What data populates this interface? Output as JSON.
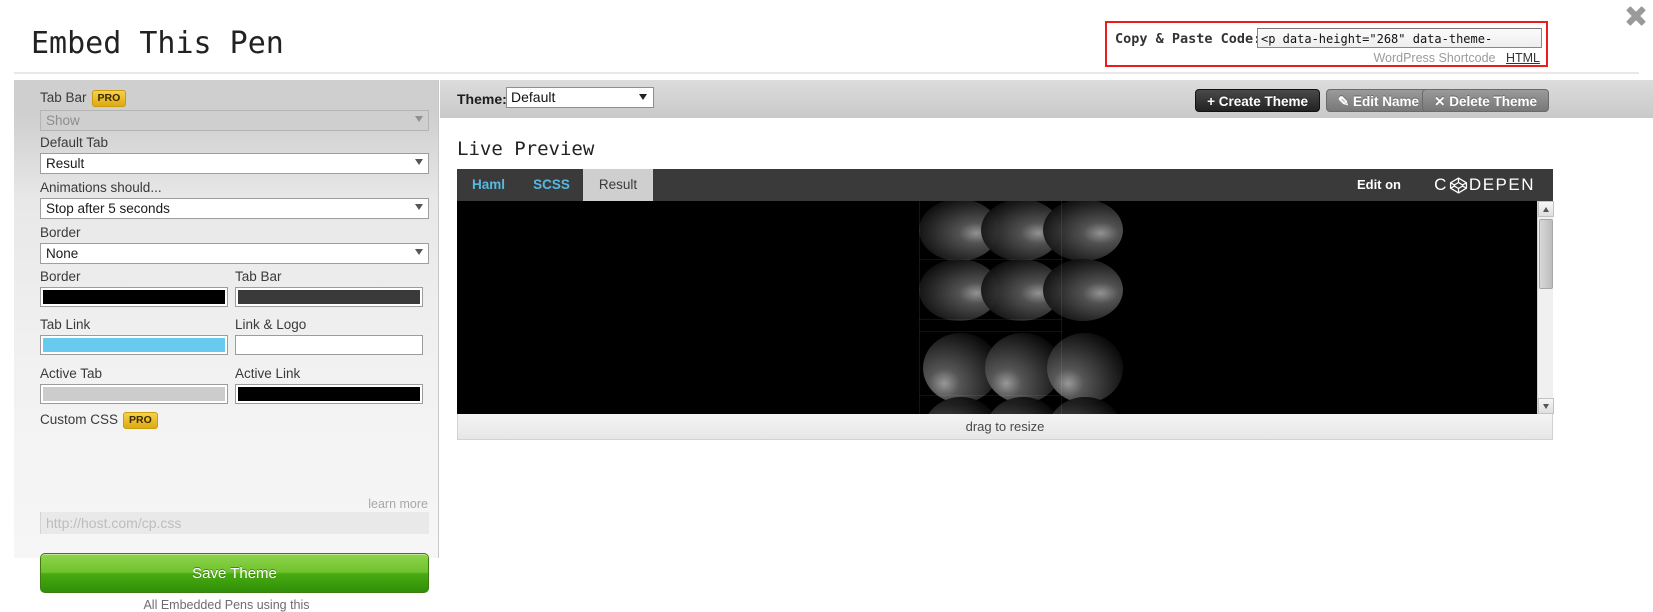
{
  "page": {
    "title": "Embed This Pen",
    "close_icon": "close-x-icon"
  },
  "copy_paste": {
    "label": "Copy & Paste Code:",
    "code_value": "<p data-height=\"268\" data-theme-",
    "wordpress_link": "WordPress Shortcode",
    "html_link": "HTML"
  },
  "sidebar": {
    "fields": [
      {
        "label": "Tab Bar",
        "pro": "PRO",
        "value": "Show",
        "disabled": true
      },
      {
        "label": "Default Tab",
        "pro": "",
        "value": "Result",
        "disabled": false
      },
      {
        "label": "Animations should...",
        "pro": "",
        "value": "Stop after 5 seconds",
        "disabled": false
      },
      {
        "label": "Border",
        "pro": "",
        "value": "None",
        "disabled": false
      }
    ],
    "colors": [
      {
        "label": "Border",
        "hex": "#000000"
      },
      {
        "label": "Tab Bar",
        "hex": "#3a3a3a"
      },
      {
        "label": "Tab Link",
        "hex": "#69caf0"
      },
      {
        "label": "Link & Logo",
        "hex": "#ffffff"
      },
      {
        "label": "Active Tab",
        "hex": "#cccccc"
      },
      {
        "label": "Active Link",
        "hex": "#000000"
      }
    ],
    "custom_css": {
      "label": "Custom CSS",
      "pro": "PRO",
      "learn_more": "learn more",
      "placeholder": "http://host.com/cp.css",
      "value": ""
    },
    "save_label": "Save Theme",
    "save_note": "All Embedded Pens using this"
  },
  "theme_bar": {
    "label": "Theme:",
    "selected": "Default",
    "create_label": "+ Create Theme",
    "edit_label": "✎ Edit Name",
    "delete_label": "✕ Delete Theme"
  },
  "preview": {
    "heading": "Live Preview",
    "tabs": [
      {
        "label": "Haml",
        "active": false
      },
      {
        "label": "SCSS",
        "active": false
      },
      {
        "label": "Result",
        "active": true
      }
    ],
    "edit_on": "Edit on",
    "logo_text_left": "C",
    "logo_text_right": "DEPEN",
    "drag_label": "drag to resize",
    "background": "#000000"
  }
}
